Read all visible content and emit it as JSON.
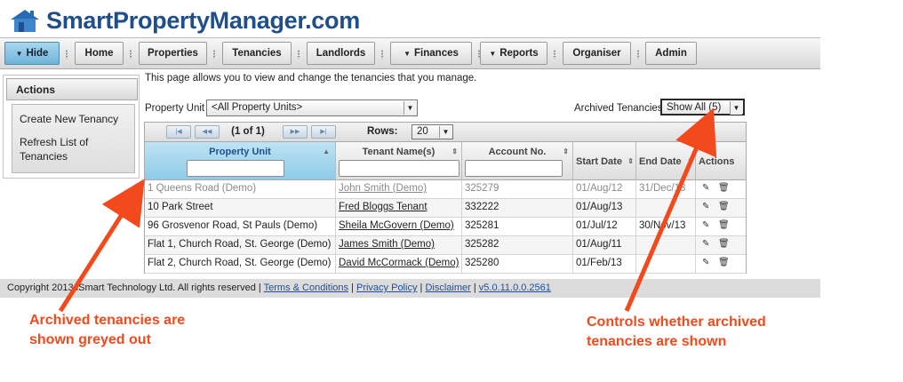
{
  "header": {
    "logo_text": "SmartPropertyManager.com"
  },
  "nav": {
    "hide": "Hide",
    "home": "Home",
    "properties": "Properties",
    "tenancies": "Tenancies",
    "landlords": "Landlords",
    "finances": "Finances",
    "reports": "Reports",
    "organiser": "Organiser",
    "admin": "Admin"
  },
  "sidebar": {
    "title": "Actions",
    "items": [
      "Create New Tenancy",
      "Refresh List of Tenancies"
    ]
  },
  "main": {
    "intro": "This page allows you to view and change the tenancies that you manage.",
    "property_unit_label": "Property Unit",
    "property_unit_value": "<All Property Units>",
    "archived_label": "Archived Tenancies",
    "archived_value": "Show All (5)"
  },
  "pager": {
    "info": "(1 of 1)",
    "rows_label": "Rows:",
    "rows_value": "20"
  },
  "table": {
    "columns": [
      "Property Unit",
      "Tenant Name(s)",
      "Account No.",
      "Start Date",
      "End Date",
      "Actions"
    ],
    "rows": [
      {
        "unit": "1 Queens Road (Demo)",
        "tenant": "John Smith (Demo)",
        "account": "325279",
        "start": "01/Aug/12",
        "end": "31/Dec/13",
        "archived": true
      },
      {
        "unit": "10 Park Street",
        "tenant": "Fred Bloggs Tenant",
        "account": "332222",
        "start": "01/Aug/13",
        "end": "",
        "archived": false
      },
      {
        "unit": "96 Grosvenor Road, St Pauls (Demo)",
        "tenant": "Sheila McGovern (Demo)",
        "account": "325281",
        "start": "01/Jul/12",
        "end": "30/Nov/13",
        "archived": false
      },
      {
        "unit": "Flat 1, Church Road, St. George (Demo)",
        "tenant": "James Smith (Demo)",
        "account": "325282",
        "start": "01/Aug/11",
        "end": "",
        "archived": false
      },
      {
        "unit": "Flat 2, Church Road, St. George (Demo)",
        "tenant": "David McCormack (Demo)",
        "account": "325280",
        "start": "01/Feb/13",
        "end": "",
        "archived": false
      }
    ]
  },
  "footer": {
    "copyright": "Copyright 2013 iSmart Technology Ltd. All rights reserved",
    "terms": "Terms & Conditions",
    "privacy": "Privacy Policy",
    "disclaimer": "Disclaimer",
    "version": "v5.0.11.0.0.2561"
  },
  "annotations": {
    "left": [
      "Archived tenancies are",
      "shown greyed out"
    ],
    "right": [
      "Controls whether archived",
      "tenancies are shown"
    ]
  },
  "colors": {
    "brand": "#1f4f8a",
    "annotation": "#f24a1c",
    "active_nav": "#6fb3d8"
  }
}
